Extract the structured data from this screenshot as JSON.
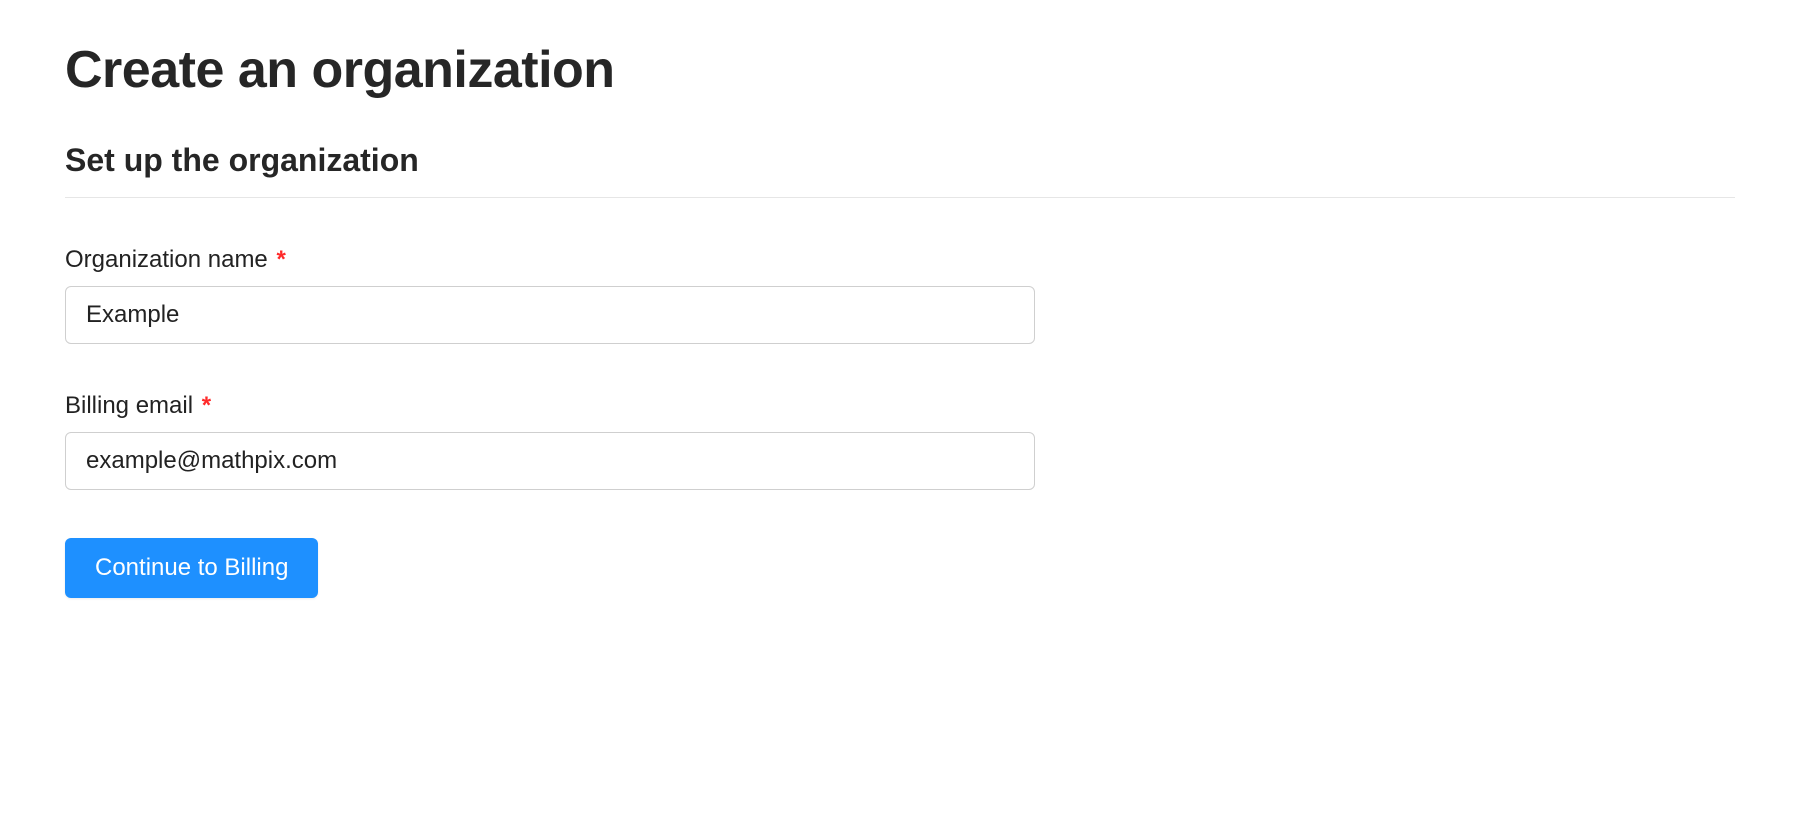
{
  "page": {
    "title": "Create an organization",
    "section_title": "Set up the organization"
  },
  "form": {
    "org_name": {
      "label": "Organization name",
      "required_mark": "*",
      "value": "Example"
    },
    "billing_email": {
      "label": "Billing email",
      "required_mark": "*",
      "value": "example@mathpix.com"
    },
    "submit_label": "Continue to Billing"
  }
}
